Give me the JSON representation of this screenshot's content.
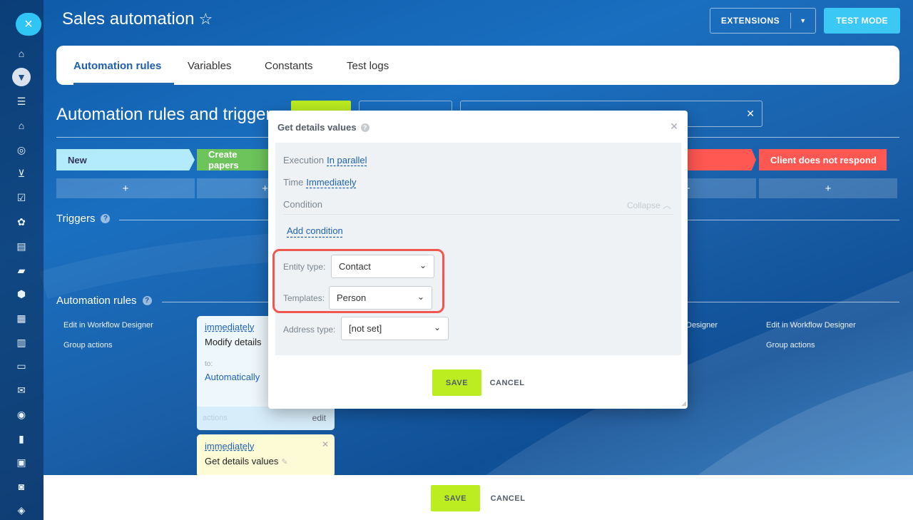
{
  "header": {
    "title": "Sales automation",
    "extensions_label": "EXTENSIONS",
    "test_mode_label": "TEST MODE"
  },
  "tabs": [
    {
      "label": "Automation rules",
      "active": true
    },
    {
      "label": "Variables"
    },
    {
      "label": "Constants"
    },
    {
      "label": "Test logs"
    }
  ],
  "section_title": "Automation rules and triggers",
  "stages": {
    "new": "New",
    "create_papers": "Create papers",
    "client_no_response": "Client does not respond"
  },
  "plus": "+",
  "triggers_label": "Triggers",
  "automation_rules_label": "Automation rules",
  "links": {
    "edit_in_designer": "Edit in Workflow Designer",
    "group_actions": "Group actions",
    "designer_partial": "Designer"
  },
  "rule_card_1": {
    "when": "immediately",
    "name": "Modify details",
    "to_label": "to:",
    "to_value": "Automatically",
    "actions": "actions",
    "edit": "edit"
  },
  "rule_card_2": {
    "when": "immediately",
    "name": "Get details values"
  },
  "modal": {
    "title": "Get details values",
    "execution_label": "Execution",
    "execution_value": "In parallel",
    "time_label": "Time",
    "time_value": "Immediately",
    "condition_label": "Condition",
    "collapse_label": "Collapse",
    "add_condition": "Add condition",
    "entity_type_label": "Entity type:",
    "entity_type_value": "Contact",
    "templates_label": "Templates:",
    "templates_value": "Person",
    "address_type_label": "Address type:",
    "address_type_value": "[not set]",
    "save": "SAVE",
    "cancel": "CANCEL"
  },
  "bottom": {
    "save": "SAVE",
    "cancel": "CANCEL"
  },
  "colors": {
    "accent_blue": "#1f5fb0",
    "save_green": "#bbed21",
    "test_mode_cyan": "#3bc8f5",
    "stage_red": "#ff5752",
    "highlight_red": "#f0574e"
  }
}
